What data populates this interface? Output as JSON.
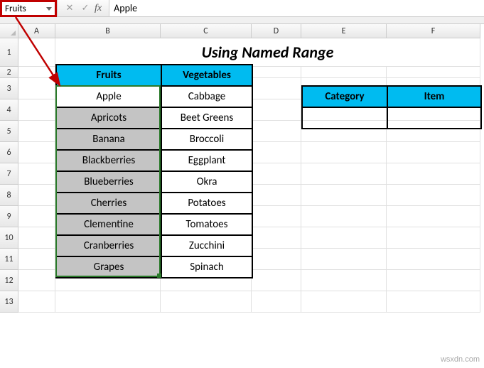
{
  "namebox": {
    "value": "Fruits"
  },
  "formula_bar": {
    "cancel": "✕",
    "confirm": "✓",
    "fx": "fx",
    "value": "Apple"
  },
  "columns": [
    "A",
    "B",
    "C",
    "D",
    "E",
    "F"
  ],
  "rows": [
    "1",
    "2",
    "3",
    "4",
    "5",
    "6",
    "7",
    "8",
    "9",
    "10",
    "11",
    "12",
    "13"
  ],
  "title": "Using Named Range",
  "table": {
    "headers": [
      "Fruits",
      "Vegetables"
    ],
    "rows": [
      [
        "Apple",
        "Cabbage"
      ],
      [
        "Apricots",
        "Beet Greens"
      ],
      [
        "Banana",
        "Broccoli"
      ],
      [
        "Blackberries",
        "Eggplant"
      ],
      [
        "Blueberries",
        "Okra"
      ],
      [
        "Cherries",
        "Potatoes"
      ],
      [
        "Clementine",
        "Tomatoes"
      ],
      [
        "Cranberries",
        "Zucchini"
      ],
      [
        "Grapes",
        "Spinach"
      ]
    ]
  },
  "side_table": {
    "headers": [
      "Category",
      "Item"
    ],
    "rows": [
      [
        "",
        ""
      ]
    ]
  },
  "watermark": "wsxdn.com"
}
